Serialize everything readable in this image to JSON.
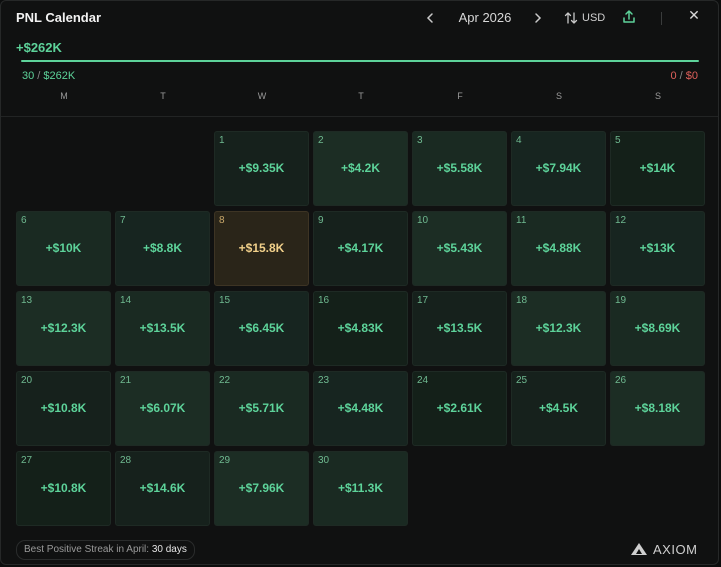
{
  "header": {
    "title": "PNL Calendar",
    "month": "Apr 2026",
    "prev_icon": "chevron-left-icon",
    "next_icon": "chevron-right-icon",
    "currency": "USD",
    "close_glyph": "✕"
  },
  "summary": {
    "total": "+$262K",
    "positive_days": "30",
    "positive_sum": "$262K",
    "negative_days": "0",
    "negative_sum": "$0",
    "separator": " / ",
    "progress_fraction": 1.0
  },
  "weekdays": [
    "M",
    "T",
    "W",
    "T",
    "F",
    "S",
    "S"
  ],
  "days": [
    {
      "day": "1",
      "value": "+$9.35K"
    },
    {
      "day": "2",
      "value": "+$4.2K"
    },
    {
      "day": "3",
      "value": "+$5.58K"
    },
    {
      "day": "4",
      "value": "+$7.94K"
    },
    {
      "day": "5",
      "value": "+$14K"
    },
    {
      "day": "6",
      "value": "+$10K"
    },
    {
      "day": "7",
      "value": "+$8.8K"
    },
    {
      "day": "8",
      "value": "+$15.8K"
    },
    {
      "day": "9",
      "value": "+$4.17K"
    },
    {
      "day": "10",
      "value": "+$5.43K"
    },
    {
      "day": "11",
      "value": "+$4.88K"
    },
    {
      "day": "12",
      "value": "+$13K"
    },
    {
      "day": "13",
      "value": "+$12.3K"
    },
    {
      "day": "14",
      "value": "+$13.5K"
    },
    {
      "day": "15",
      "value": "+$6.45K"
    },
    {
      "day": "16",
      "value": "+$4.83K"
    },
    {
      "day": "17",
      "value": "+$13.5K"
    },
    {
      "day": "18",
      "value": "+$12.3K"
    },
    {
      "day": "19",
      "value": "+$8.69K"
    },
    {
      "day": "20",
      "value": "+$10.8K"
    },
    {
      "day": "21",
      "value": "+$6.07K"
    },
    {
      "day": "22",
      "value": "+$5.71K"
    },
    {
      "day": "23",
      "value": "+$4.48K"
    },
    {
      "day": "24",
      "value": "+$2.61K"
    },
    {
      "day": "25",
      "value": "+$4.5K"
    },
    {
      "day": "26",
      "value": "+$8.18K"
    },
    {
      "day": "27",
      "value": "+$10.8K"
    },
    {
      "day": "28",
      "value": "+$14.6K"
    },
    {
      "day": "29",
      "value": "+$7.96K"
    },
    {
      "day": "30",
      "value": "+$11.3K"
    }
  ],
  "highlight_day": "8",
  "colors": {
    "positive": "#5dd39a",
    "negative": "#e0605b",
    "highlight": "#f1d08a"
  },
  "footer": {
    "streak_label": "Best Positive Streak in April:",
    "streak_value": "30 days",
    "brand_name": "AXIOM",
    "brand_icon": "axiom-logo-icon"
  }
}
